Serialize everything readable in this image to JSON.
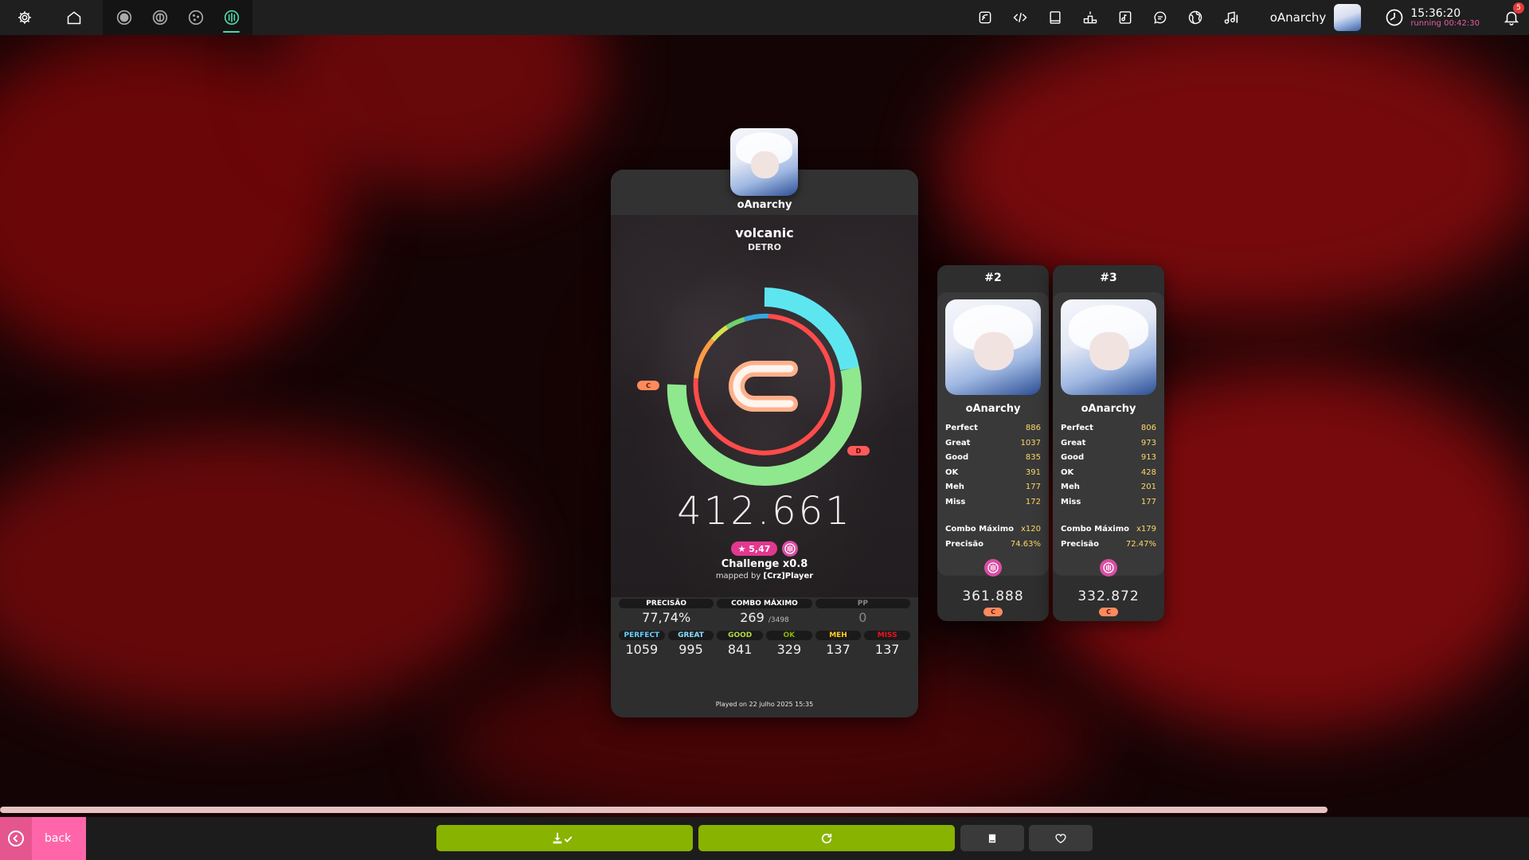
{
  "toolbar": {
    "left_icons": [
      "gear-icon",
      "home-icon"
    ],
    "rulesets": [
      "osu-ruleset-icon",
      "taiko-ruleset-icon",
      "catch-ruleset-icon",
      "mania-ruleset-icon"
    ],
    "active_ruleset": "mania-ruleset-icon",
    "right_icons": [
      "changelog-icon",
      "code-icon",
      "wiki-icon",
      "rankings-icon",
      "beatmap-listing-icon",
      "chat-icon",
      "world-icon",
      "music-icon"
    ],
    "username": "oAnarchy",
    "clock_time": "15:36:20",
    "clock_running": "running 00:42:30",
    "notification_count": "5"
  },
  "player": {
    "name": "oAnarchy"
  },
  "beatmap": {
    "title": "volcanic",
    "artist": "DETRO",
    "difficulty": "Challenge x0.8",
    "mapped_by_prefix": "mapped by",
    "mapper": "[Crz]Player",
    "star_rating": "★ 5,47"
  },
  "score": {
    "grade": "C",
    "total": "412.661",
    "grade_labels": {
      "left": "C",
      "right": "D"
    },
    "accuracy_fraction": 0.7774,
    "played_on": "Played on 22 julho 2025 15:35"
  },
  "stats_top": [
    {
      "label": "PRECISÃO",
      "value": "77,74%",
      "suffix": ""
    },
    {
      "label": "COMBO MÁXIMO",
      "value": "269",
      "suffix": "/3498"
    },
    {
      "label": "PP",
      "value": "0",
      "suffix": ""
    }
  ],
  "stats_hits": [
    {
      "label": "PERFECT",
      "value": "1059",
      "color": "#66ccff"
    },
    {
      "label": "GREAT",
      "value": "995",
      "color": "#88ddff"
    },
    {
      "label": "GOOD",
      "value": "841",
      "color": "#b3d944"
    },
    {
      "label": "OK",
      "value": "329",
      "color": "#88b300"
    },
    {
      "label": "MEH",
      "value": "137",
      "color": "#ffcc22"
    },
    {
      "label": "MISS",
      "value": "137",
      "color": "#ed1121"
    }
  ],
  "side_cards": [
    {
      "rank": "#2",
      "name": "oAnarchy",
      "stats": [
        {
          "label": "Perfect",
          "value": "886"
        },
        {
          "label": "Great",
          "value": "1037"
        },
        {
          "label": "Good",
          "value": "835"
        },
        {
          "label": "OK",
          "value": "391"
        },
        {
          "label": "Meh",
          "value": "177"
        },
        {
          "label": "Miss",
          "value": "172"
        }
      ],
      "combo_label": "Combo Máximo",
      "combo_value": "x120",
      "accuracy_label": "Precisão",
      "accuracy_value": "74.63%",
      "score": "361.888",
      "grade": "C"
    },
    {
      "rank": "#3",
      "name": "oAnarchy",
      "stats": [
        {
          "label": "Perfect",
          "value": "806"
        },
        {
          "label": "Great",
          "value": "973"
        },
        {
          "label": "Good",
          "value": "913"
        },
        {
          "label": "OK",
          "value": "428"
        },
        {
          "label": "Meh",
          "value": "201"
        },
        {
          "label": "Miss",
          "value": "177"
        }
      ],
      "combo_label": "Combo Máximo",
      "combo_value": "x179",
      "accuracy_label": "Precisão",
      "accuracy_value": "72.47%",
      "score": "332.872",
      "grade": "C"
    }
  ],
  "footer": {
    "back_label": "back",
    "buttons": [
      "download-icon",
      "retry-icon",
      "leaderboard-icon",
      "favourite-icon"
    ]
  },
  "colors": {
    "accent_pink": "#ff66aa",
    "green_button": "#88b300",
    "mod_pink": "#d94ea2",
    "grade_c": "#ff8a5c",
    "grade_d": "#ff5a5a"
  }
}
